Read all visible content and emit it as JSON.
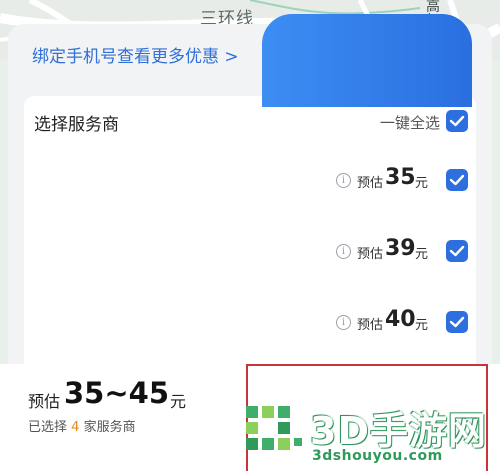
{
  "map": {
    "road_label": "三环线",
    "side_label": "高架"
  },
  "banner": {
    "bind_phone": "绑定手机号查看更多优惠 >"
  },
  "providers": {
    "title": "选择服务商",
    "select_all_label": "一键全选",
    "select_all_checked": true,
    "items": [
      {
        "est_label": "预估",
        "price": "35",
        "unit": "元",
        "checked": true
      },
      {
        "est_label": "预估",
        "price": "39",
        "unit": "元",
        "checked": true
      },
      {
        "est_label": "预估",
        "price": "40",
        "unit": "元",
        "checked": true
      }
    ]
  },
  "summary": {
    "est_label": "预估",
    "range": "35~45",
    "unit": "元",
    "selected_prefix": "已选择",
    "selected_count": "4",
    "selected_suffix": "家服务商"
  },
  "watermark": {
    "title": "3D手游网",
    "url": "3dshouyou.com"
  },
  "colors": {
    "accent": "#2e6fe0",
    "link": "#2f6fd8",
    "highlight_frame": "#c9333a",
    "count_orange": "#e58a1f"
  }
}
